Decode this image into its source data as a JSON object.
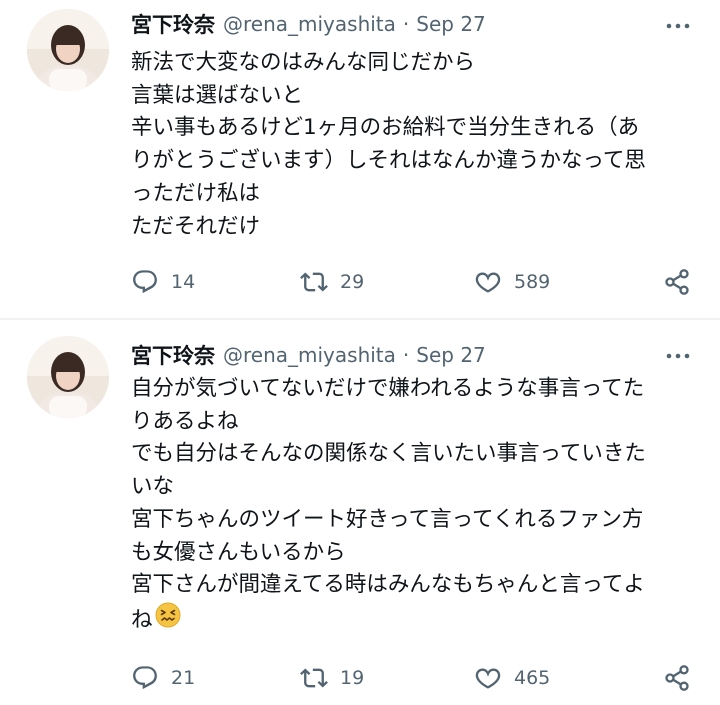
{
  "tweets": [
    {
      "name": "宮下玲奈",
      "handle": "@rena_miyashita",
      "separator": "·",
      "date": "Sep 27",
      "lines": [
        "新法で大変なのはみんな同じだから",
        "言葉は選ばないと",
        "辛い事もあるけど1ヶ月のお給料で当分生きれる（あ",
        "りがとうございます）しそれはなんか違うかなって思",
        "っただけ私は",
        "ただそれだけ"
      ],
      "stats": {
        "replies": "14",
        "retweets": "29",
        "likes": "589"
      }
    },
    {
      "name": "宮下玲奈",
      "handle": "@rena_miyashita",
      "separator": "·",
      "date": "Sep 27",
      "lines": [
        "自分が気づいてないだけで嫌われるような事言ってた",
        "りあるよね",
        "でも自分はそんなの関係なく言いたい事言っていきた",
        "いな",
        "宮下ちゃんのツイート好きって言ってくれるファン方",
        "も女優さんもいるから",
        "宮下さんが間違えてる時はみんなもちゃんと言ってよ",
        "ね"
      ],
      "trailing_emoji": "confounded-face",
      "stats": {
        "replies": "21",
        "retweets": "19",
        "likes": "465"
      }
    }
  ],
  "colors": {
    "text": "#0f1419",
    "secondary": "#536471",
    "divider": "#eff3f4"
  }
}
